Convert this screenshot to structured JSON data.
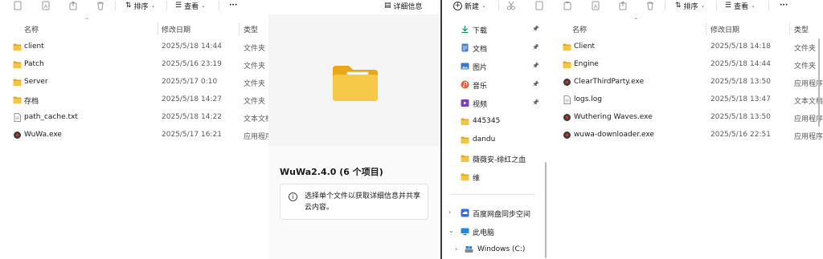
{
  "left": {
    "toolbar": {
      "sort_label": "排序",
      "view_label": "查看",
      "more_label": "···",
      "details_label": "详细信息"
    },
    "columns": {
      "name": "名称",
      "date": "修改日期",
      "type": "类型"
    },
    "files": [
      {
        "name": "client",
        "date": "2025/5/18 14:44",
        "type": "文件夹",
        "icon": "folder-icon"
      },
      {
        "name": "Patch",
        "date": "2025/5/16 23:19",
        "type": "文件夹",
        "icon": "folder-icon"
      },
      {
        "name": "Server",
        "date": "2025/5/17 0:10",
        "type": "文件夹",
        "icon": "folder-icon"
      },
      {
        "name": "存档",
        "date": "2025/5/18 14:27",
        "type": "文件夹",
        "icon": "folder-icon"
      },
      {
        "name": "path_cache.txt",
        "date": "2025/5/18 14:22",
        "type": "文本文档",
        "icon": "text-file-icon"
      },
      {
        "name": "WuWa.exe",
        "date": "2025/5/17 16:21",
        "type": "应用程序",
        "icon": "app-icon"
      }
    ],
    "details": {
      "title": "WuWa2.4.0 (6 个项目)",
      "info": "选择单个文件以获取详细信息并共享云内容。"
    }
  },
  "right": {
    "toolbar": {
      "new_label": "新建",
      "sort_label": "排序",
      "view_label": "查看",
      "more_label": "···"
    },
    "nav": [
      {
        "label": "下载",
        "icon": "download-icon",
        "pinned": true
      },
      {
        "label": "文档",
        "icon": "document-icon",
        "pinned": true
      },
      {
        "label": "图片",
        "icon": "pictures-icon",
        "pinned": true
      },
      {
        "label": "音乐",
        "icon": "music-icon",
        "pinned": true
      },
      {
        "label": "视频",
        "icon": "video-icon",
        "pinned": true
      },
      {
        "label": "445345",
        "icon": "folder-icon",
        "pinned": false
      },
      {
        "label": "dandu",
        "icon": "folder-icon",
        "pinned": false
      },
      {
        "label": "薇薇安-绯红之血",
        "icon": "folder-icon",
        "pinned": false
      },
      {
        "label": "维",
        "icon": "folder-icon",
        "pinned": false
      }
    ],
    "nav_lower": [
      {
        "label": "百度网盘同步空间",
        "icon": "cloud-sync-icon",
        "expand": ">"
      },
      {
        "label": "此电脑",
        "icon": "this-pc-icon",
        "expand": "v"
      },
      {
        "label": "Windows (C:)",
        "icon": "drive-icon",
        "expand": ">"
      }
    ],
    "columns": {
      "name": "名称",
      "date": "修改日期",
      "type": "类型"
    },
    "files": [
      {
        "name": "Client",
        "date": "2025/5/18 14:18",
        "type": "文件夹",
        "icon": "folder-icon"
      },
      {
        "name": "Engine",
        "date": "2025/5/18 14:44",
        "type": "文件夹",
        "icon": "folder-icon"
      },
      {
        "name": "ClearThirdParty.exe",
        "date": "2025/5/18 13:50",
        "type": "应用程序",
        "icon": "app-icon"
      },
      {
        "name": "logs.log",
        "date": "2025/5/18 13:47",
        "type": "文本文档",
        "icon": "text-file-icon"
      },
      {
        "name": "Wuthering Waves.exe",
        "date": "2025/5/18 13:50",
        "type": "应用程序",
        "icon": "app-icon"
      },
      {
        "name": "wuwa-downloader.exe",
        "date": "2025/5/16 22:51",
        "type": "应用程序",
        "icon": "app-icon"
      }
    ]
  },
  "colors": {
    "folder": "#f4c542",
    "folder_dark": "#e0a820",
    "accent": "#0067c0"
  }
}
